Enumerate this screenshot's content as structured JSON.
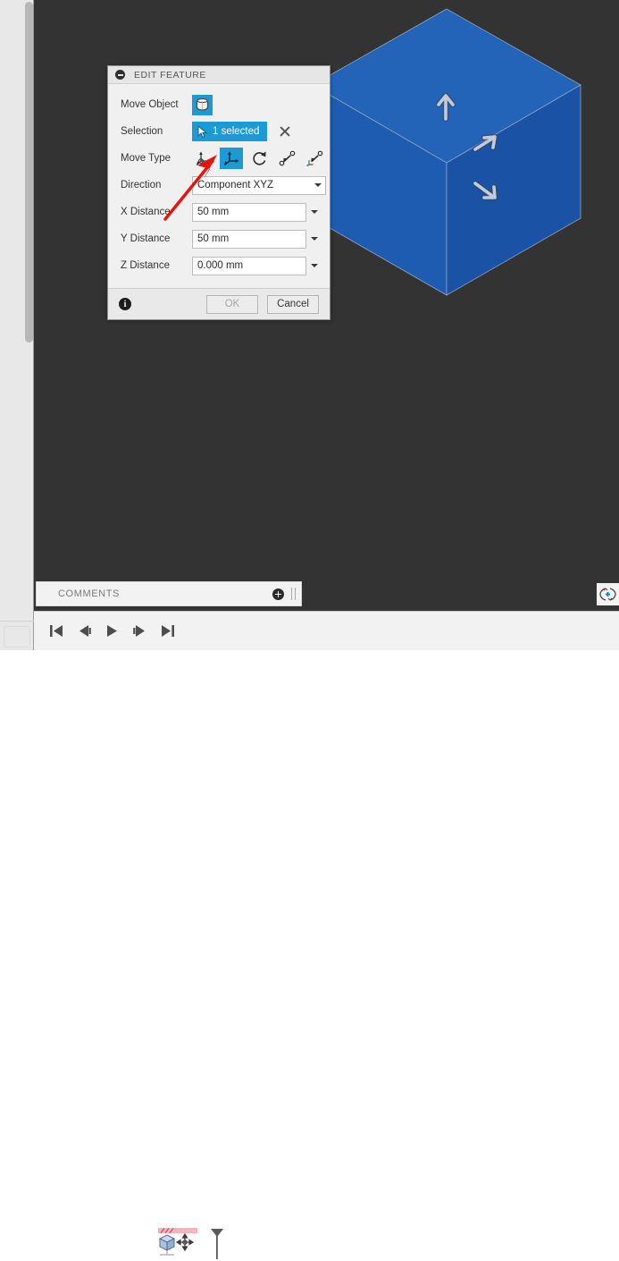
{
  "app": {
    "viewport_background": "#333333",
    "model_color": "#1f5fb4",
    "accent_color": "#1b9ad6",
    "annotation_color": "#e8140c"
  },
  "viewport": {
    "model": {
      "name": "cube-body",
      "shape": "isometric-cube",
      "top_face_color": "#2364b8",
      "left_face_color": "#1f5cb0",
      "right_face_color": "#1a53a5",
      "edge_color": "#7c8fae"
    },
    "manipulator_arrows": [
      {
        "name": "move-arrow-up",
        "glyph": "↑",
        "direction": "up"
      },
      {
        "name": "move-arrow-upright",
        "glyph": "↗",
        "direction": "up-right"
      },
      {
        "name": "move-arrow-downright",
        "glyph": "↘",
        "direction": "down-right"
      }
    ]
  },
  "dialog": {
    "title": "EDIT FEATURE",
    "collapse_icon": "minus-circle-icon",
    "rows": {
      "move_object": {
        "label": "Move Object",
        "icon": "solid-body-icon",
        "selected": true
      },
      "selection": {
        "label": "Selection",
        "value": "1 selected",
        "cursor_icon": "pointer-icon",
        "clear_icon": "close-icon"
      },
      "move_type": {
        "label": "Move Type",
        "options": [
          {
            "name": "move-type-free-drag",
            "icon": "free-drag-axes-icon",
            "active": false
          },
          {
            "name": "move-type-translate",
            "icon": "translate-axes-icon",
            "active": true
          },
          {
            "name": "move-type-rotate",
            "icon": "rotate-arc-icon",
            "active": false
          },
          {
            "name": "move-type-point-to-point",
            "icon": "point-to-point-icon",
            "active": false
          },
          {
            "name": "move-type-align-csys",
            "icon": "align-coordinate-system-icon",
            "active": false
          }
        ]
      },
      "direction": {
        "label": "Direction",
        "value": "Component XYZ"
      },
      "x_distance": {
        "label": "X Distance",
        "value": "50 mm"
      },
      "y_distance": {
        "label": "Y Distance",
        "value": "50 mm"
      },
      "z_distance": {
        "label": "Z Distance",
        "value": "0.000 mm"
      }
    },
    "footer": {
      "info_icon": "info-icon",
      "info_glyph": "i",
      "ok_label": "OK",
      "ok_enabled": false,
      "cancel_label": "Cancel",
      "cancel_enabled": true
    }
  },
  "comments_bar": {
    "label": "COMMENTS",
    "add_icon": "add-comment-icon",
    "grip_icon": "drag-grip-icon"
  },
  "orbit_widget": {
    "icon": "orbit-navigation-icon"
  },
  "timeline": {
    "playback": [
      {
        "name": "skip-to-start-button",
        "icon": "skip-start-icon"
      },
      {
        "name": "step-back-button",
        "icon": "step-back-icon"
      },
      {
        "name": "play-button",
        "icon": "play-icon"
      },
      {
        "name": "step-forward-button",
        "icon": "step-forward-icon"
      },
      {
        "name": "skip-to-end-button",
        "icon": "skip-end-icon"
      }
    ],
    "node": {
      "name": "timeline-feature-move",
      "icon": "cube-move-feature-icon",
      "status_band_color": "#f7b3bb",
      "editing": true
    },
    "end_marker": {
      "name": "timeline-end-marker",
      "icon": "timeline-marker-icon"
    }
  }
}
